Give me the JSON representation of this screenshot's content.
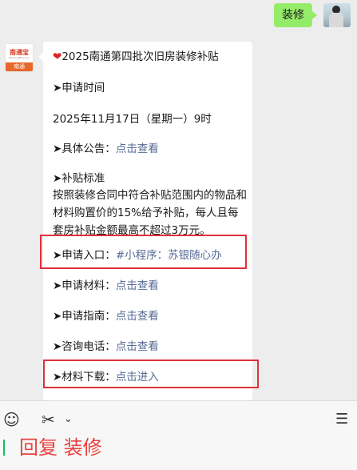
{
  "outgoing": {
    "text": "装修"
  },
  "bot": {
    "logo_name": "南通宝",
    "logo_url_text": "NantongBao.com",
    "logo_city": "南通"
  },
  "message": {
    "title": "2025南通第四批次旧房装修补贴",
    "apply_time_label": "➤申请时间",
    "apply_time_value": "2025年11月17日（星期一）9时",
    "notice_label": "➤具体公告：",
    "notice_link": "点击查看",
    "standard_label": "➤补贴标准",
    "standard_text": "按照装修合同中符合补贴范围内的物品和材料购置价的15%给予补贴，每人且每套房补贴金额最高不超过3万元。",
    "entry_label": "➤申请入口：",
    "entry_link": "#小程序：苏银随心办",
    "materials_label": "➤申请材料：",
    "materials_link": "点击查看",
    "guide_label": "➤申请指南：",
    "guide_link": "点击查看",
    "phone_label": "➤咨询电话：",
    "phone_link": "点击查看",
    "download_label": "➤材料下载：",
    "download_link": "点击进入"
  },
  "reply": {
    "text": "回复 装修"
  },
  "icons": {
    "emoji": "emoji-icon",
    "scissors": "scissors-icon",
    "chevron": "chevron-down-icon",
    "menu": "menu-list-icon"
  }
}
